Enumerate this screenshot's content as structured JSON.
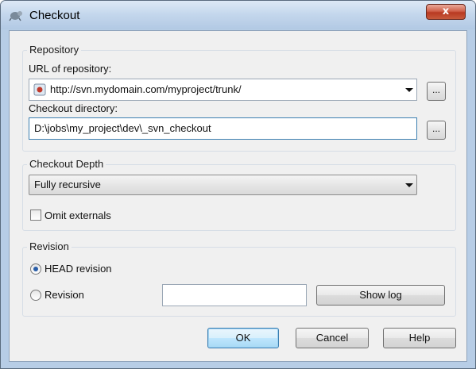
{
  "window": {
    "title": "Checkout",
    "close_label": "x"
  },
  "repository": {
    "group_title": "Repository",
    "url_label": "URL of repository:",
    "url_value": "http://svn.mydomain.com/myproject/trunk/",
    "browse_label": "...",
    "dir_label": "Checkout directory:",
    "dir_value": "D:\\jobs\\my_project\\dev\\_svn_checkout"
  },
  "depth": {
    "group_title": "Checkout Depth",
    "selected": "Fully recursive",
    "omit_externals_label": "Omit externals",
    "omit_externals_checked": false
  },
  "revision": {
    "group_title": "Revision",
    "head_label": "HEAD revision",
    "revision_label": "Revision",
    "revision_value": "",
    "selected": "HEAD revision",
    "show_log_label": "Show log"
  },
  "buttons": {
    "ok": "OK",
    "cancel": "Cancel",
    "help": "Help"
  },
  "colors": {
    "titlebar": "#c3d6ec",
    "close": "#c75a3c",
    "default_button": "#3c7fb1"
  }
}
